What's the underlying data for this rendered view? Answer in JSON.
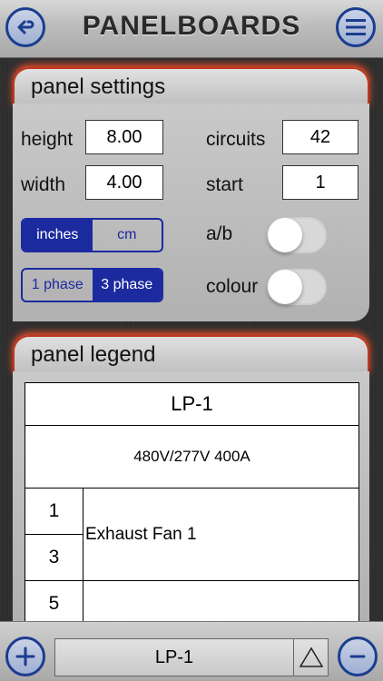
{
  "header": {
    "title": "PANELBOARDS",
    "back_icon": "back-arrow-icon",
    "menu_icon": "menu-icon"
  },
  "panel_settings": {
    "title": "panel settings",
    "height_label": "height",
    "height_value": "8.00",
    "width_label": "width",
    "width_value": "4.00",
    "circuits_label": "circuits",
    "circuits_value": "42",
    "start_label": "start",
    "start_value": "1",
    "units": {
      "options": [
        "inches",
        "cm"
      ],
      "selected": "inches"
    },
    "phase": {
      "options": [
        "1 phase",
        "3 phase"
      ],
      "selected": "3 phase"
    },
    "ab_label": "a/b",
    "ab_on": false,
    "colour_label": "colour",
    "colour_on": false
  },
  "panel_legend": {
    "title": "panel legend",
    "name": "LP-1",
    "rating": "480V/277V 400A",
    "rows": [
      {
        "circuit": "1",
        "description": "Exhaust Fan 1"
      },
      {
        "circuit": "3",
        "description": ""
      },
      {
        "circuit": "5",
        "description": ""
      }
    ]
  },
  "footer": {
    "panel_name": "LP-1",
    "add_icon": "plus-icon",
    "remove_icon": "minus-icon",
    "up_icon": "triangle-up-icon"
  },
  "colors": {
    "accent": "#1c2aa0",
    "tab_glow": "#c0361b"
  }
}
